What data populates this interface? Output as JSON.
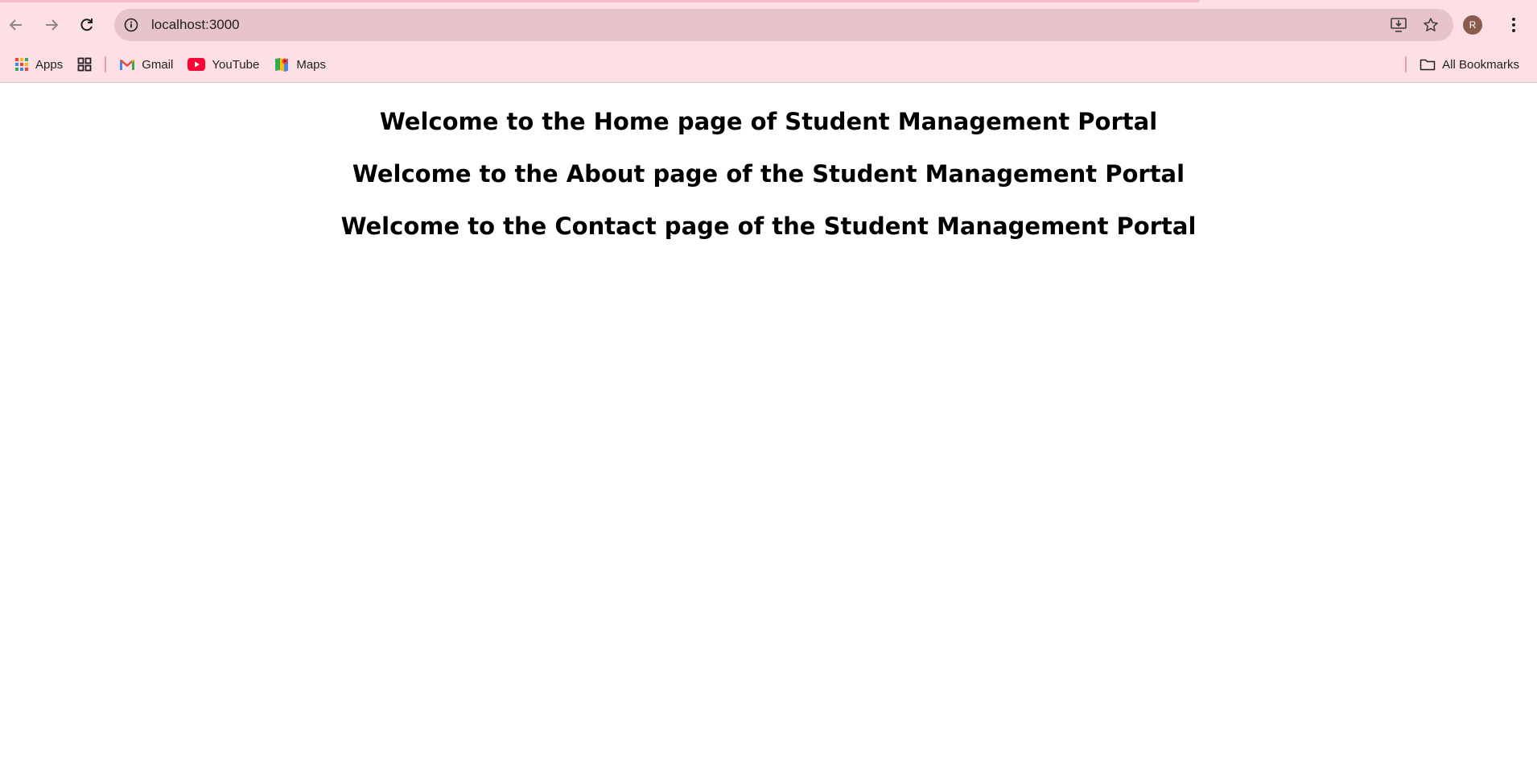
{
  "browser": {
    "url": "localhost:3000",
    "profile_initial": "R",
    "bookmarks": [
      {
        "label": "Apps",
        "icon": "apps-grid-icon"
      },
      {
        "label": "",
        "icon": "tab-groups-icon"
      },
      {
        "label": "Gmail",
        "icon": "gmail-icon"
      },
      {
        "label": "YouTube",
        "icon": "youtube-icon"
      },
      {
        "label": "Maps",
        "icon": "maps-icon"
      }
    ],
    "all_bookmarks_label": "All Bookmarks",
    "colors": {
      "frame": "#fde0e6",
      "omnibox": "#e6c4ca",
      "avatar": "#8a5a4a",
      "separator": "#f19aab"
    }
  },
  "page": {
    "headings": [
      "Welcome to the Home page of Student Management Portal",
      "Welcome to the About page of the Student Management Portal",
      "Welcome to the Contact page of the Student Management Portal"
    ]
  }
}
